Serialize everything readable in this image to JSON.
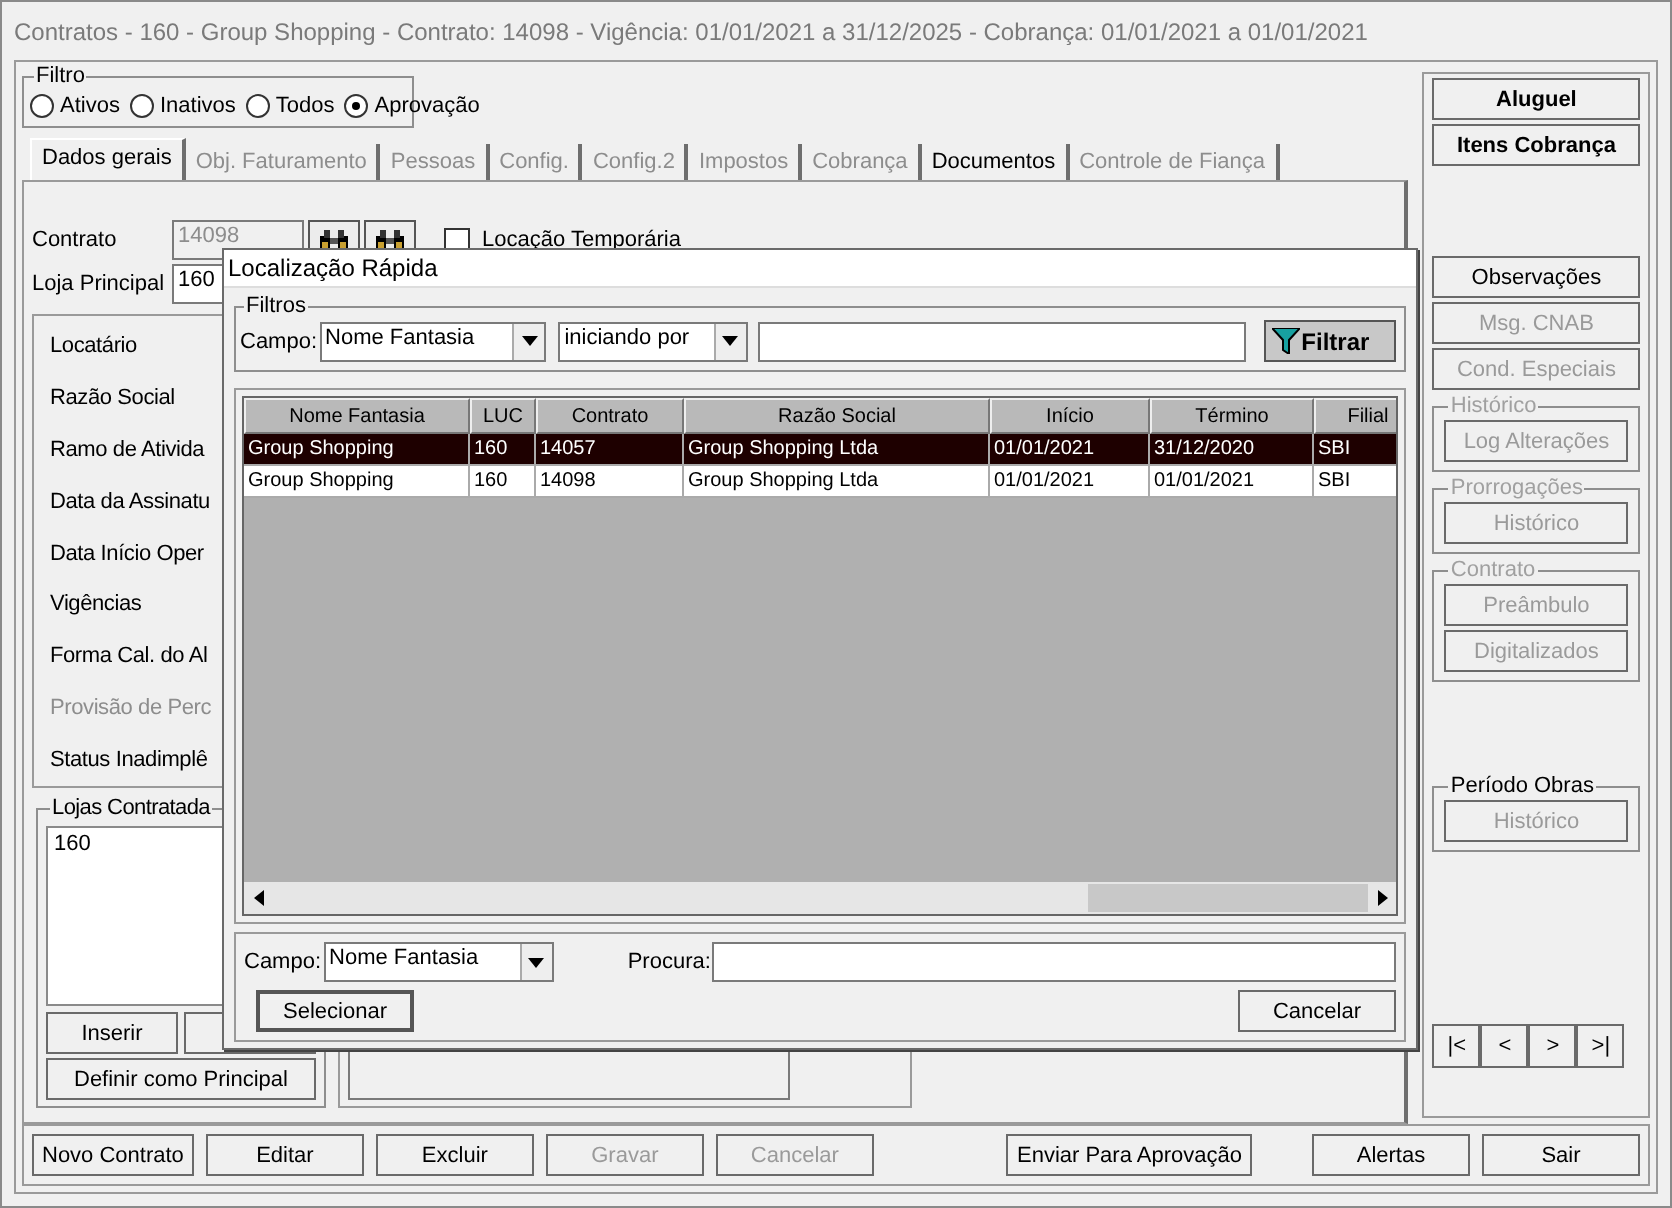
{
  "window": {
    "title": "Contratos - 160 - Group Shopping - Contrato: 14098 - Vigência: 01/01/2021 a 31/12/2025 - Cobrança: 01/01/2021 a 01/01/2021"
  },
  "filter": {
    "title": "Filtro",
    "options": [
      {
        "label": "Ativos",
        "selected": false
      },
      {
        "label": "Inativos",
        "selected": false
      },
      {
        "label": "Todos",
        "selected": false
      },
      {
        "label": "Aprovação",
        "selected": true
      }
    ]
  },
  "tabs": [
    {
      "label": "Dados gerais",
      "selected": true,
      "disabled": false
    },
    {
      "label": "Obj. Faturamento",
      "selected": false,
      "disabled": true
    },
    {
      "label": "Pessoas",
      "selected": false,
      "disabled": true
    },
    {
      "label": "Config.",
      "selected": false,
      "disabled": true
    },
    {
      "label": "Config.2",
      "selected": false,
      "disabled": true
    },
    {
      "label": "Impostos",
      "selected": false,
      "disabled": true
    },
    {
      "label": "Cobrança",
      "selected": false,
      "disabled": true
    },
    {
      "label": "Documentos",
      "selected": false,
      "disabled": false
    },
    {
      "label": "Controle de Fiança",
      "selected": false,
      "disabled": true
    }
  ],
  "form": {
    "contract_label": "Contrato",
    "contract_value": "14098",
    "temporary": {
      "label": "Locação Temporária",
      "checked": false
    },
    "store_label": "Loja Principal",
    "store_value": "160",
    "fields": [
      {
        "label": "Locatário",
        "disabled": false
      },
      {
        "label": "Razão Social",
        "disabled": false
      },
      {
        "label": "Ramo de Ativida",
        "disabled": false
      },
      {
        "label": "Data da Assinatu",
        "disabled": false
      },
      {
        "label": "Data Início Oper",
        "disabled": false
      },
      {
        "label": "Vigências",
        "disabled": false
      },
      {
        "label": "Forma Cal. do Al",
        "disabled": false
      },
      {
        "label": "Provisão de Perc",
        "disabled": true
      },
      {
        "label": "Status Inadimplê",
        "disabled": false
      }
    ]
  },
  "stores": {
    "title": "Lojas Contratada",
    "items": [
      "160"
    ],
    "insert_button": "Inserir",
    "principal_button": "Definir como Principal"
  },
  "side_buttons": [
    {
      "label": "Aluguel",
      "bold": true,
      "disabled": false
    },
    {
      "label": "Itens Cobrança",
      "bold": true,
      "disabled": false
    }
  ],
  "side_buttons_2": [
    {
      "label": "Observações",
      "bold": false,
      "disabled": false
    },
    {
      "label": "Msg. CNAB",
      "bold": false,
      "disabled": true
    },
    {
      "label": "Cond. Especiais",
      "bold": false,
      "disabled": true
    }
  ],
  "side_groups": [
    {
      "title": "Histórico",
      "disabled": true,
      "buttons": [
        {
          "label": "Log Alterações",
          "disabled": true
        }
      ]
    },
    {
      "title": "Prorrogações",
      "disabled": true,
      "buttons": [
        {
          "label": "Histórico",
          "disabled": true
        }
      ]
    },
    {
      "title": "Contrato",
      "disabled": true,
      "buttons": [
        {
          "label": "Preâmbulo",
          "disabled": true
        },
        {
          "label": "Digitalizados",
          "disabled": true
        }
      ]
    },
    {
      "title": "Período Obras",
      "disabled": false,
      "buttons": [
        {
          "label": "Histórico",
          "disabled": true
        }
      ]
    }
  ],
  "nav_buttons": [
    "|<",
    "<",
    ">",
    ">|"
  ],
  "bottom_buttons": [
    {
      "label": "Novo Contrato",
      "disabled": false
    },
    {
      "label": "Editar",
      "disabled": false
    },
    {
      "label": "Excluir",
      "disabled": false
    },
    {
      "label": "Gravar",
      "disabled": true
    },
    {
      "label": "Cancelar",
      "disabled": true
    },
    {
      "label": "Enviar Para Aprovação",
      "disabled": false
    },
    {
      "label": "Alertas",
      "disabled": false
    },
    {
      "label": "Sair",
      "disabled": false
    }
  ],
  "dialog": {
    "title": "Localização Rápida",
    "filters": {
      "title": "Filtros",
      "field_label": "Campo:",
      "field_value": "Nome Fantasia",
      "operator_value": "iniciando por",
      "filter_button": "Filtrar"
    },
    "table": {
      "columns": [
        "Nome Fantasia",
        "LUC",
        "Contrato",
        "Razão Social",
        "Início",
        "Término",
        "Filial"
      ],
      "rows": [
        {
          "selected": true,
          "cells": [
            "Group Shopping",
            "160",
            "14057",
            "Group Shopping Ltda",
            "01/01/2021",
            "31/12/2020",
            "SBI"
          ]
        },
        {
          "selected": false,
          "cells": [
            "Group Shopping",
            "160",
            "14098",
            "Group Shopping Ltda",
            "01/01/2021",
            "01/01/2021",
            "SBI"
          ]
        }
      ]
    },
    "search": {
      "field_label": "Campo:",
      "field_value": "Nome Fantasia",
      "search_label": "Procura:"
    },
    "select_button": "Selecionar",
    "cancel_button": "Cancelar"
  }
}
